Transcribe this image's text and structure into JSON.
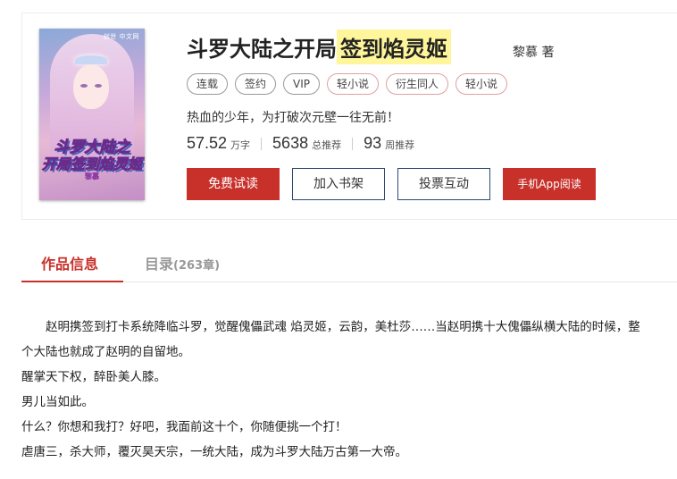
{
  "book": {
    "title_main": "斗罗大陆之开局",
    "title_highlight": "签到焰灵姬",
    "author": "黎慕 著",
    "tags": [
      "连载",
      "签约",
      "VIP",
      "轻小说",
      "衍生同人",
      "轻小说"
    ],
    "tagline": "热血的少年，为打破次元壁一往无前！",
    "stats": {
      "words": "57.52",
      "words_unit": "万字",
      "total_recommend": "5638",
      "total_recommend_unit": "总推荐",
      "week_recommend": "93",
      "week_recommend_unit": "周推荐"
    }
  },
  "cover": {
    "publisher": "创世 中文网",
    "title_line1": "斗罗大陆之",
    "title_line2": "开局签到焰灵姬",
    "author": "黎慕"
  },
  "buttons": {
    "free_trial": "免费试读",
    "add_shelf": "加入书架",
    "vote": "投票互动",
    "app_read": "手机App阅读"
  },
  "tabs": {
    "info": "作品信息",
    "toc": "目录",
    "toc_count": "(263章)"
  },
  "description": [
    "赵明携签到打卡系统降临斗罗，觉醒傀儡武魂 焰灵姬，云韵，美杜莎……当赵明携十大傀儡纵横大陆的时候，整个大陆也就成了赵明的自留地。",
    "醒掌天下权，醉卧美人膝。",
    "男儿当如此。",
    "什么？你想和我打？好吧，我面前这十个，你随便挑一个打！",
    "虐唐三，杀大师，覆灭昊天宗，一统大陆，成为斗罗大陆万古第一大帝。"
  ],
  "colors": {
    "accent": "#c8302a",
    "highlight": "#fff59a",
    "button_border": "#2d4a72"
  }
}
